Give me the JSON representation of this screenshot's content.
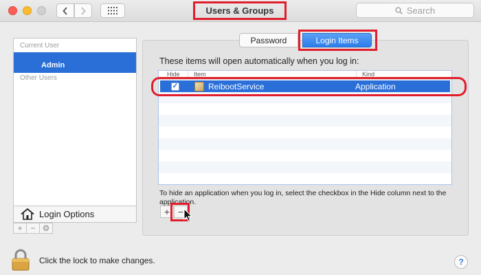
{
  "window": {
    "title": "Users & Groups"
  },
  "toolbar": {
    "search_placeholder": "Search",
    "back_icon": "chevron-left-icon",
    "forward_icon": "chevron-right-icon",
    "grid_icon": "grid-icon"
  },
  "sidebar": {
    "current_user_header": "Current User",
    "current_user": "Admin",
    "other_users_header": "Other Users",
    "login_options": "Login Options",
    "buttons": [
      "+",
      "−",
      "⚙"
    ]
  },
  "tabs": [
    {
      "label": "Password",
      "selected": false
    },
    {
      "label": "Login Items",
      "selected": true
    }
  ],
  "login_items": {
    "intro": "These items will open automatically when you log in:",
    "columns": {
      "hide": "Hide",
      "item": "Item",
      "kind": "Kind"
    },
    "rows": [
      {
        "hide": true,
        "name": "ReibootService",
        "kind": "Application"
      }
    ],
    "hint": "To hide an application when you log in, select the checkbox in the Hide column next to the application.",
    "add_label": "+",
    "remove_label": "−"
  },
  "footer": {
    "lock_text": "Click the lock to make changes.",
    "help_label": "?"
  },
  "colors": {
    "accent": "#2a6fd8",
    "highlight": "#e11d2b"
  }
}
